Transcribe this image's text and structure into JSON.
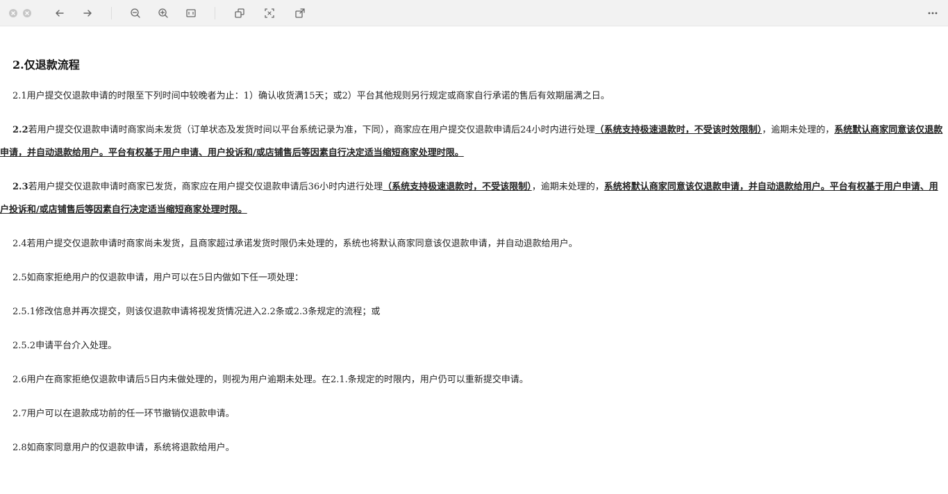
{
  "toolbar": {
    "buttons": [
      {
        "name": "close-window",
        "icon": "close-icon"
      },
      {
        "name": "minimize-window",
        "icon": "minimize-icon"
      },
      {
        "name": "back",
        "icon": "arrow-left-icon"
      },
      {
        "name": "forward",
        "icon": "arrow-right-icon"
      },
      {
        "name": "zoom-out",
        "icon": "zoom-out-icon"
      },
      {
        "name": "zoom-in",
        "icon": "zoom-in-icon"
      },
      {
        "name": "fit-width",
        "icon": "fit-width-icon"
      },
      {
        "name": "copy",
        "icon": "copy-icon"
      },
      {
        "name": "screenshot",
        "icon": "screenshot-icon"
      },
      {
        "name": "open-external",
        "icon": "open-external-icon"
      },
      {
        "name": "more",
        "icon": "more-icon"
      }
    ]
  },
  "doc": {
    "title": "2.仅退款流程",
    "p1": "2.1用户提交仅退款申请的时限至下列时间中较晚者为止：1）确认收货满15天；或2）平台其他规则另行规定或商家自行承诺的售后有效期届满之日。",
    "p2_num": "2.2",
    "p2_text1": "若用户提交仅退款申请时商家尚未发货（订单状态及发货时间以平台系统记录为准，下同），商家应在用户提交仅退款申请后24小时内进行处理",
    "p2_ul1": "（系统支持极速退款时，不受该时效限制）",
    "p2_text2": "，逾期未处理的，",
    "p2_ul2": "系统默认商家同意该仅退款申请，并自动退款给用户。平台有权基于用户申请、用户投诉和/或店铺售后等因素自行决定适当缩短商家处理时限。",
    "p3_num": "2.3",
    "p3_text1": "若用户提交仅退款申请时商家已发货，商家应在用户提交仅退款申请后36小时内进行处理",
    "p3_ul1": "（系统支持极速退款时，不受该限制）",
    "p3_text2": "，逾期未处理的，",
    "p3_ul2": "系统将默认商家同意该仅退款申请，并自动退款给用户。平台有权基于用户申请、用户投诉和/或店铺售后等因素自行决定适当缩短商家处理时限。",
    "p4": "2.4若用户提交仅退款申请时商家尚未发货，且商家超过承诺发货时限仍未处理的，系统也将默认商家同意该仅退款申请，并自动退款给用户。",
    "p5": "2.5如商家拒绝用户的仅退款申请，用户可以在5日内做如下任一项处理：",
    "p6": "2.5.1修改信息并再次提交，则该仅退款申请将视发货情况进入2.2条或2.3条规定的流程；或",
    "p7": "2.5.2申请平台介入处理。",
    "p8": "2.6用户在商家拒绝仅退款申请后5日内未做处理的，则视为用户逾期未处理。在2.1.条规定的时限内，用户仍可以重新提交申请。",
    "p9": "2.7用户可以在退款成功前的任一环节撤销仅退款申请。",
    "p10": "2.8如商家同意用户的仅退款申请，系统将退款给用户。"
  }
}
